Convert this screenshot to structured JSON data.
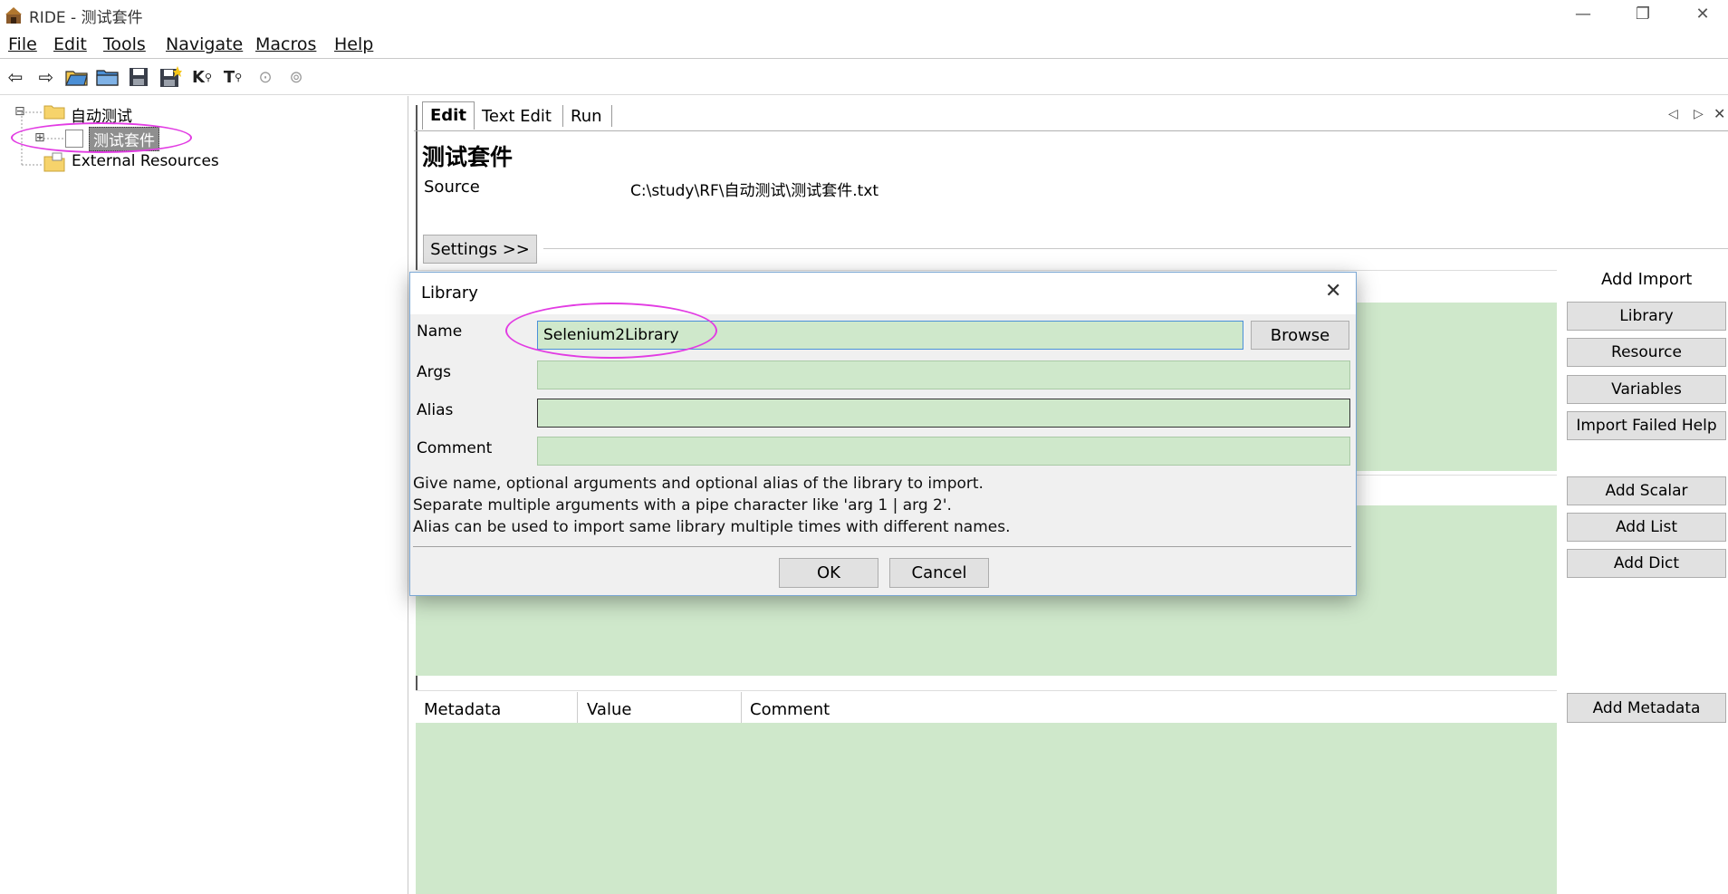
{
  "window": {
    "title": "RIDE - 测试套件",
    "minimize": "—",
    "restore": "❐",
    "close": "✕"
  },
  "menu": [
    "File",
    "Edit",
    "Tools",
    "Navigate",
    "Macros",
    "Help"
  ],
  "toolbar_icons": [
    "arrow-left-icon",
    "arrow-right-icon",
    "open-folder-icon",
    "open-directory-icon",
    "save-icon",
    "save-all-icon",
    "search-keywords-icon",
    "search-tests-icon",
    "run-icon",
    "stop-icon"
  ],
  "tree": {
    "root": "自动测试",
    "child": "测试套件",
    "external": "External Resources",
    "expand_minus": "⊟",
    "expand_plus": "⊞"
  },
  "tabs": [
    "Edit",
    "Text Edit",
    "Run"
  ],
  "tab_nav": {
    "prev": "◁",
    "next": "▷",
    "close": "✕"
  },
  "suite": {
    "title": "测试套件",
    "source_label": "Source",
    "source_value": "C:\\study\\RF\\自动测试\\测试套件.txt",
    "settings_button": "Settings >>"
  },
  "import_panel": {
    "heading": "Add Import",
    "buttons": [
      "Library",
      "Resource",
      "Variables",
      "Import Failed Help"
    ]
  },
  "variable_buttons": [
    "Add Scalar",
    "Add List",
    "Add Dict"
  ],
  "metadata": {
    "headers": [
      "Metadata",
      "Value",
      "Comment"
    ],
    "add_button": "Add Metadata"
  },
  "dialog": {
    "title": "Library",
    "close": "✕",
    "fields": {
      "name_label": "Name",
      "name_value": "Selenium2Library",
      "browse": "Browse",
      "args_label": "Args",
      "args_value": "",
      "alias_label": "Alias",
      "alias_value": "",
      "comment_label": "Comment",
      "comment_value": ""
    },
    "help": [
      "Give name, optional arguments and optional alias of the library to import.",
      "Separate multiple arguments with a pipe character like 'arg 1 | arg 2'.",
      "Alias can be used to import same library multiple times with different names."
    ],
    "ok": "OK",
    "cancel": "Cancel"
  },
  "colors": {
    "grid_green": "#cfe8cb",
    "highlight": "#e23ce3",
    "dialog_border": "#7aa7d4"
  }
}
